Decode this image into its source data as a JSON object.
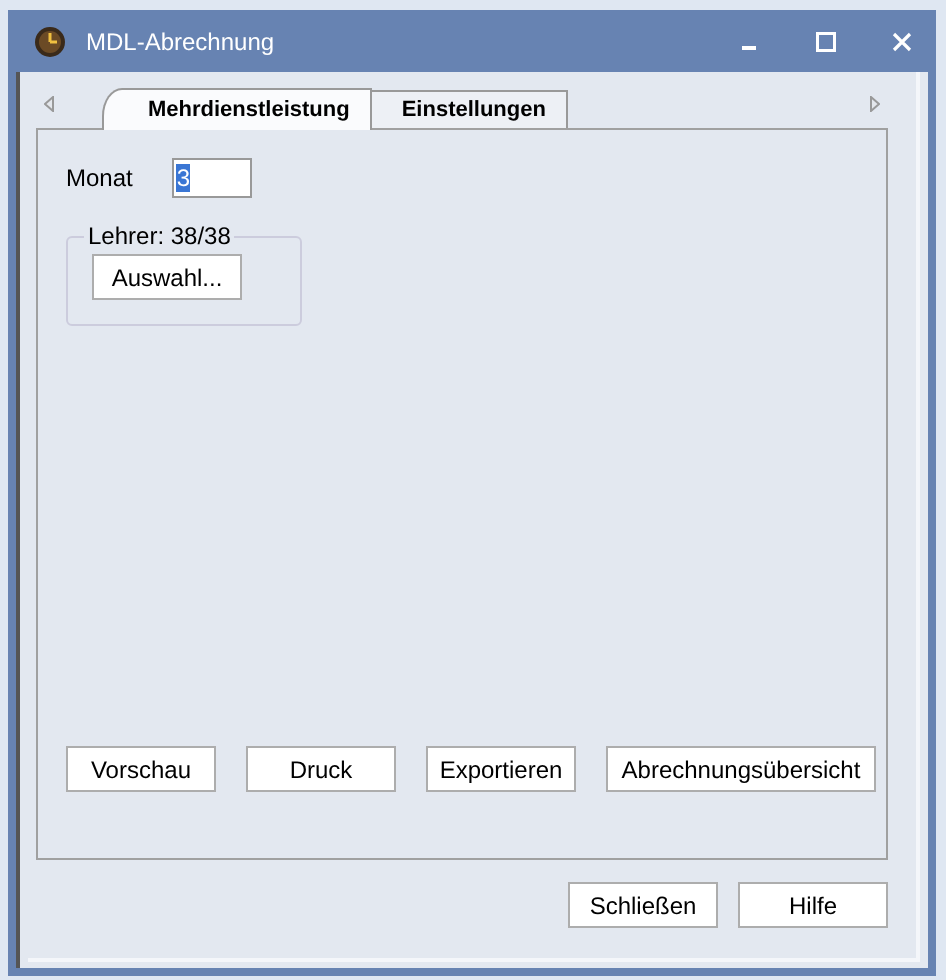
{
  "window": {
    "title": "MDL-Abrechnung"
  },
  "tabs": [
    {
      "label": "Mehrdienstleistung",
      "selected": true
    },
    {
      "label": "Einstellungen",
      "selected": false
    }
  ],
  "month": {
    "label": "Monat",
    "value": "3",
    "text_selected": true
  },
  "teacher_group": {
    "title": "Lehrer: 38/38",
    "button": "Auswahl..."
  },
  "actions": [
    "Vorschau",
    "Druck",
    "Exportieren",
    "Abrechnungsübersicht"
  ],
  "footer_buttons": [
    "Schließen",
    "Hilfe"
  ]
}
